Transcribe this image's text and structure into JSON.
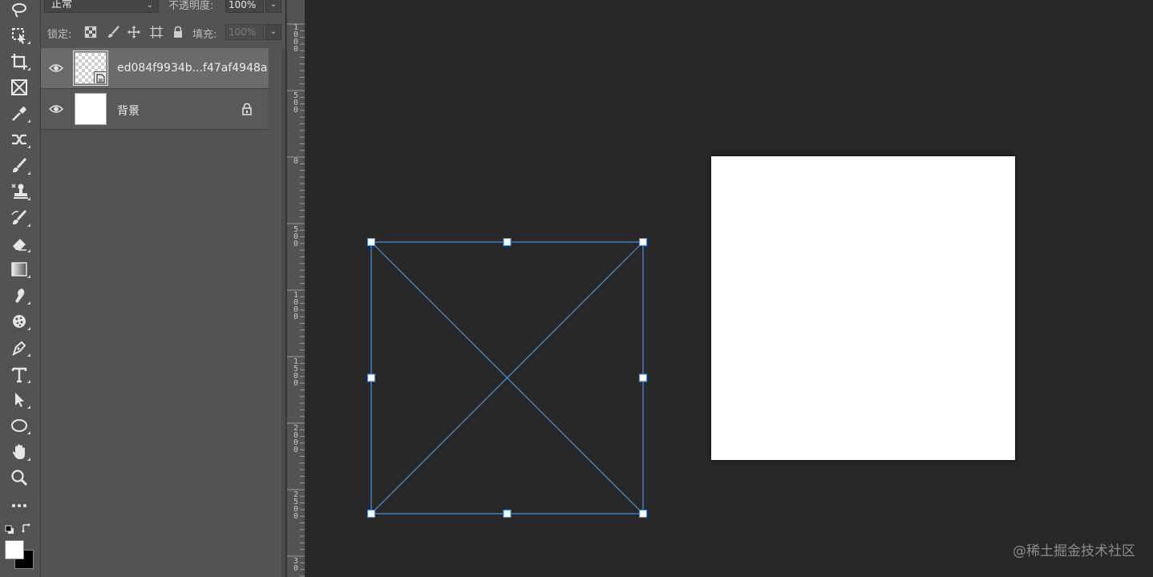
{
  "layers_panel": {
    "blend_mode": "正常",
    "opacity_label": "不透明度:",
    "opacity_value": "100%",
    "lock_label": "锁定:",
    "fill_label": "填充:",
    "fill_value": "100%",
    "layers": [
      {
        "name": "ed084f9934b...f47af4948a",
        "visible": true,
        "selected": true,
        "thumbnail": "transparent-smart-object"
      },
      {
        "name": "背景",
        "visible": true,
        "selected": false,
        "thumbnail": "white",
        "locked": true
      }
    ]
  },
  "toolbar": {
    "tools": [
      "lasso-tool",
      "object-selection-tool",
      "crop-tool",
      "frame-tool",
      "eyedropper-tool",
      "spot-healing-tool",
      "brush-tool",
      "clone-stamp-tool",
      "history-brush-tool",
      "eraser-tool",
      "gradient-tool",
      "smudge-tool",
      "sponge-tool",
      "pen-tool",
      "type-tool",
      "path-selection-tool",
      "ellipse-tool",
      "hand-tool",
      "zoom-tool",
      "more-tools"
    ]
  },
  "ruler": {
    "labels": [
      "1 0 0 0",
      "5 0 0",
      "0",
      "5 0 0",
      "1 0 0 0",
      "1 5 0 0",
      "2 0 0 0",
      "2 5 0 0",
      "3 0"
    ]
  },
  "canvas": {
    "document_color": "#ffffff",
    "transform_color": "#4a90e2",
    "background_color": "#282828"
  },
  "watermark": "@稀土掘金技术社区"
}
